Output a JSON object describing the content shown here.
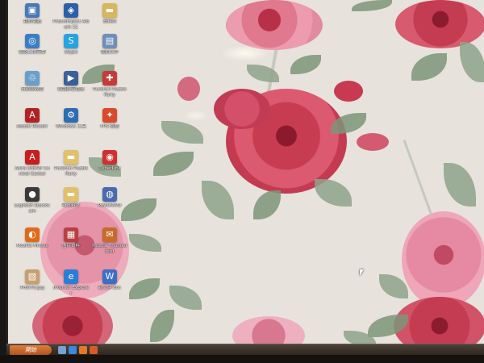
{
  "desktop": {
    "icons": [
      {
        "label": "我的電腦",
        "icon": "computer-icon",
        "color": "#4a78b8"
      },
      {
        "label": "PhotoImpact Album 11",
        "icon": "photoimpact-icon",
        "color": "#2d5fa8"
      },
      {
        "label": "資料夾",
        "icon": "folder-icon",
        "color": "#d8b65a"
      },
      {
        "label": "網路上的芳鄰",
        "icon": "network-icon",
        "color": "#3a7ec4"
      },
      {
        "label": "Skype",
        "icon": "skype-icon",
        "color": "#27a3e0"
      },
      {
        "label": "我的文件",
        "icon": "documents-icon",
        "color": "#6f8fb8"
      },
      {
        "label": "資源回收筒",
        "icon": "recycle-bin-icon",
        "color": "#6aa0c8"
      },
      {
        "label": "網路影音播放",
        "icon": "media-icon",
        "color": "#3a5f9a"
      },
      {
        "label": "PureFun Puzzle Party",
        "icon": "puzzle-icon",
        "color": "#c83a3a"
      },
      {
        "label": "Adobe Reader",
        "icon": "adobe-reader-icon",
        "color": "#b22222"
      },
      {
        "label": "Windows 工具",
        "icon": "tools-icon",
        "color": "#2e6db4"
      },
      {
        "label": "FPS 遊戲",
        "icon": "game-icon",
        "color": "#d84a2a"
      },
      {
        "label": "Avira AntiVir Control Center",
        "icon": "avira-icon",
        "color": "#c81e1e"
      },
      {
        "label": "PureFun Puzzle Party",
        "icon": "folder-icon",
        "color": "#e0c06a"
      },
      {
        "label": "CyberLink",
        "icon": "cyberlink-icon",
        "color": "#d03030"
      },
      {
        "label": "Logitech QuickCam",
        "icon": "webcam-icon",
        "color": "#3a3a3a"
      },
      {
        "label": "新資料夾",
        "icon": "folder-icon",
        "color": "#e0c06a"
      },
      {
        "label": "PowerDVD",
        "icon": "dvd-icon",
        "color": "#4a6ab0"
      },
      {
        "label": "Mozilla Firefox",
        "icon": "firefox-icon",
        "color": "#e06a1a"
      },
      {
        "label": "圖片資料",
        "icon": "image-icon",
        "color": "#b84040"
      },
      {
        "label": "Mozilla Thunderbird",
        "icon": "thunderbird-icon",
        "color": "#c86a2a"
      },
      {
        "label": "PHOTO.jpg",
        "icon": "photo-file-icon",
        "color": "#c8a070"
      },
      {
        "label": "Internet Explorer",
        "icon": "internet-explorer-icon",
        "color": "#2a7ed8"
      },
      {
        "label": "新文件.doc",
        "icon": "word-doc-icon",
        "color": "#3a6fc8"
      }
    ]
  },
  "taskbar": {
    "start_label": "開始",
    "quicklaunch": [
      {
        "icon": "show-desktop-icon",
        "color": "#7aa0d0"
      },
      {
        "icon": "ie-quicklaunch-icon",
        "color": "#3a88e0"
      },
      {
        "icon": "media-player-icon",
        "color": "#e07a2a"
      },
      {
        "icon": "firefox-quicklaunch-icon",
        "color": "#d85a2a"
      }
    ]
  },
  "colors": {
    "wallpaper": "#e8e2dc",
    "rose_red": "#c43c52",
    "rose_pink": "#e389a0",
    "leaf_green": "#8da38a"
  }
}
